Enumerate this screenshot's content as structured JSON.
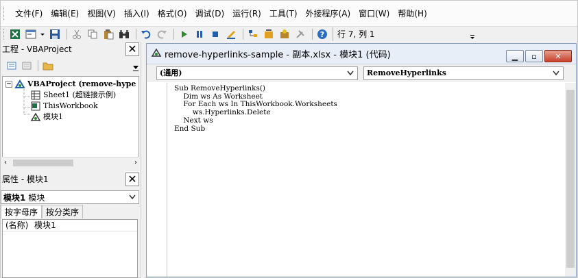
{
  "menu": [
    "文件(F)",
    "编辑(E)",
    "视图(V)",
    "插入(I)",
    "格式(O)",
    "调试(D)",
    "运行(R)",
    "工具(T)",
    "外接程序(A)",
    "窗口(W)",
    "帮助(H)"
  ],
  "toolbar": {
    "cursor_position": "行 7, 列 1"
  },
  "project_panel": {
    "title": "工程 - VBAProject",
    "tree": {
      "root": "VBAProject (remove-hype",
      "items": [
        "Sheet1 (超链接示例)",
        "ThisWorkbook",
        "模块1"
      ]
    }
  },
  "properties_panel": {
    "title": "属性 - 模块1",
    "object_name": "模块1",
    "object_type": "模块",
    "tabs": [
      "按字母序",
      "按分类序"
    ],
    "rows": [
      {
        "key": "(名称)",
        "value": "模块1"
      }
    ]
  },
  "code_window": {
    "title": "remove-hyperlinks-sample - 副本.xlsx - 模块1 (代码)",
    "object_combo": "(通用)",
    "procedure_combo": "RemoveHyperlinks",
    "code": "Sub RemoveHyperlinks()\n    Dim ws As Worksheet\n    For Each ws In ThisWorkbook.Worksheets\n        ws.Hyperlinks.Delete\n    Next ws\nEnd Sub"
  },
  "colors": {
    "excel_green": "#1e7145",
    "accent_blue": "#1f5fae",
    "close_red": "#c8402c"
  }
}
